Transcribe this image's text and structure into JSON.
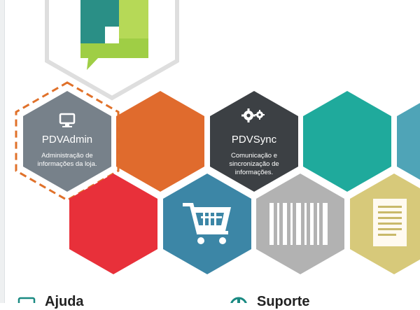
{
  "tiles": {
    "pdvadmin": {
      "title": "PDVAdmin",
      "description": "Administração de informações da loja.",
      "icon": "monitor-icon",
      "color": "#77818a",
      "selected": true,
      "highlight_color": "#e0712a"
    },
    "orange": {
      "color": "#e06b2d"
    },
    "pdvsync": {
      "title": "PDVSync",
      "description": "Comunicação e sincronização de informações.",
      "icon": "gears-icon",
      "color": "#3c4044"
    },
    "teal": {
      "color": "#1faa9c"
    },
    "blue_partial": {
      "color": "#4fa4b7"
    },
    "red": {
      "color": "#e8303a"
    },
    "cart": {
      "icon": "shopping-cart-icon",
      "color": "#3c86a6"
    },
    "barcode": {
      "icon": "barcode-icon",
      "color": "#b2b2b2"
    },
    "document": {
      "icon": "document-icon",
      "color": "#d7c97a"
    }
  },
  "logo": {
    "icon": "chat-bubble-logo",
    "colors": [
      "#2aa58c",
      "#9ccd44"
    ]
  },
  "bottom": {
    "left_label": "Ajuda",
    "left_icon": "help-book-icon",
    "right_label": "Suporte",
    "right_icon": "support-icon"
  }
}
